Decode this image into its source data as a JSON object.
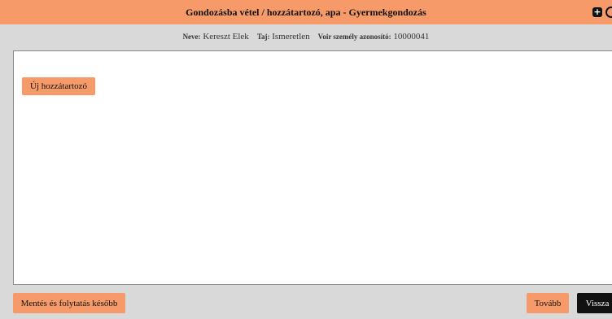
{
  "header": {
    "title": "Gondozásba vétel / hozzátartozó, apa - Gyermekgondozás",
    "icons": [
      "plus-square-icon",
      "circle-icon"
    ]
  },
  "info": {
    "name_label": "Neve:",
    "name_value": "Kereszt Elek",
    "taj_label": "Taj:",
    "taj_value": "Ismeretlen",
    "voir_label": "Voir személy azonosító:",
    "voir_value": "10000041"
  },
  "content": {
    "new_relative_label": "Új hozzátartozó"
  },
  "footer": {
    "save_later_label": "Mentés és folytatás később",
    "next_label": "Tovább",
    "back_label": "Vissza"
  },
  "colors": {
    "accent": "#f59a68",
    "background": "#d9d9d9",
    "dark_button": "#111111"
  }
}
